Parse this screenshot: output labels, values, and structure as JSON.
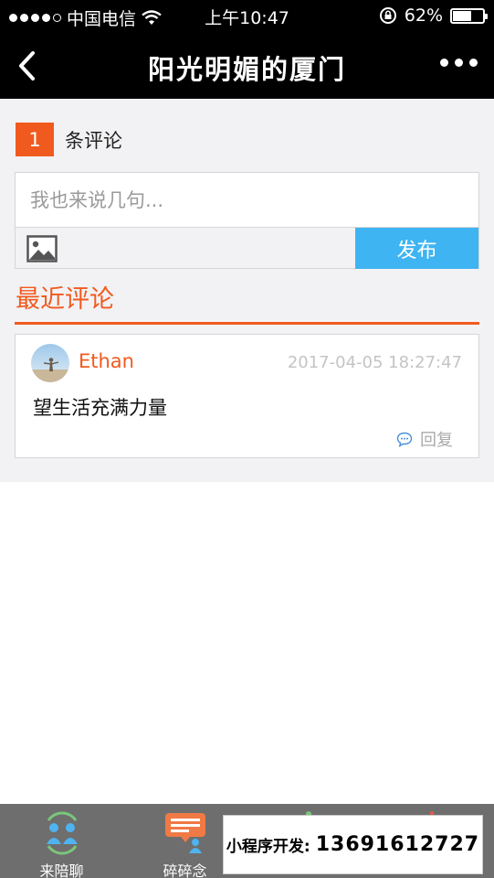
{
  "status_bar": {
    "carrier": "中国电信",
    "time": "上午10:47",
    "battery_percent_label": "62%",
    "battery_level": 0.62
  },
  "nav": {
    "title": "阳光明媚的厦门"
  },
  "comments_header": {
    "count": "1",
    "count_label": "条评论"
  },
  "composer": {
    "placeholder": "我也来说几句...",
    "value": "",
    "publish_label": "发布"
  },
  "recent": {
    "title": "最近评论",
    "comments": [
      {
        "user": "Ethan",
        "time": "2017-04-05 18:27:47",
        "text": "望生活充满力量",
        "reply_label": "回复"
      }
    ]
  },
  "tab_bar": {
    "tabs": [
      {
        "label": "来陪聊",
        "icon": "people-icon"
      },
      {
        "label": "碎碎念",
        "icon": "chat-bubble-icon"
      },
      {
        "label": "",
        "icon": "tab-icon-3"
      },
      {
        "label": "",
        "icon": "tab-icon-4"
      }
    ]
  },
  "promo": {
    "label": "小程序开发:",
    "number": "13691612727"
  },
  "colors": {
    "accent": "#f15a1f",
    "button_blue": "#3fb4f3",
    "bar_black": "#000000",
    "tab_gray": "#6e6e6e"
  }
}
